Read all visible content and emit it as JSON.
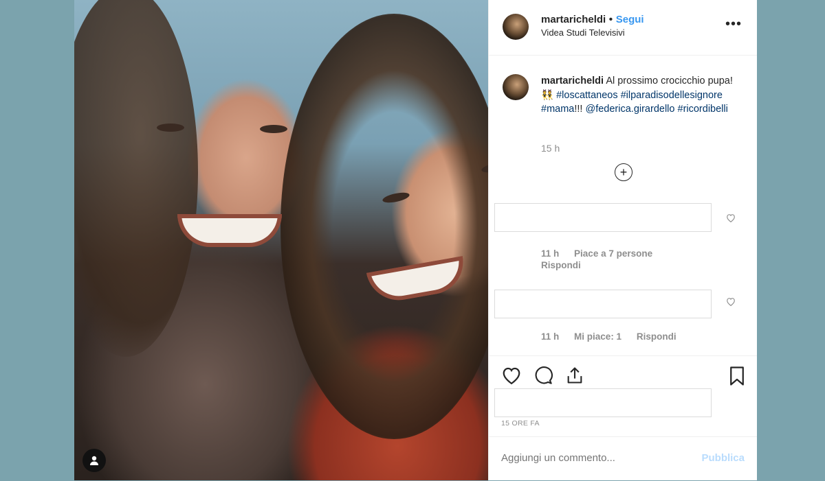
{
  "post": {
    "username": "martaricheldi",
    "separator": "•",
    "follow_label": "Segui",
    "location": "Videa Studi Televisivi",
    "more_icon": "more-horizontal-icon"
  },
  "caption": {
    "username": "martaricheldi",
    "text": "Al prossimo crocicchio pupa!",
    "emoji": "👯",
    "hashtag1": "#loscattaneos",
    "hashtag2": "#ilparadisodellesignore",
    "hashtag3": "#mama",
    "exclaim": "!!!",
    "mention": "@federica.girardello",
    "hashtag4": "#ricordibelli",
    "time": "15 h"
  },
  "comments": [
    {
      "time": "11 h",
      "likes": "Piace a 7 persone",
      "reply": "Rispondi"
    },
    {
      "time": "11 h",
      "likes": "Mi piace: 1",
      "reply": "Rispondi"
    }
  ],
  "footer": {
    "posted_ago": "15 ORE FA",
    "comment_placeholder": "Aggiungi un commento...",
    "publish_label": "Pubblica"
  },
  "icons": {
    "load_more": "plus-circle-icon",
    "comment_like": "heart-icon",
    "like": "heart-icon",
    "comment": "comment-icon",
    "share": "share-icon",
    "save": "bookmark-icon",
    "tagged_users": "user-icon"
  },
  "colors": {
    "background": "#7ba3ad",
    "link": "#003569",
    "follow": "#3897f0",
    "publish_disabled": "#b9dcfd",
    "muted": "#8e8e8e"
  }
}
